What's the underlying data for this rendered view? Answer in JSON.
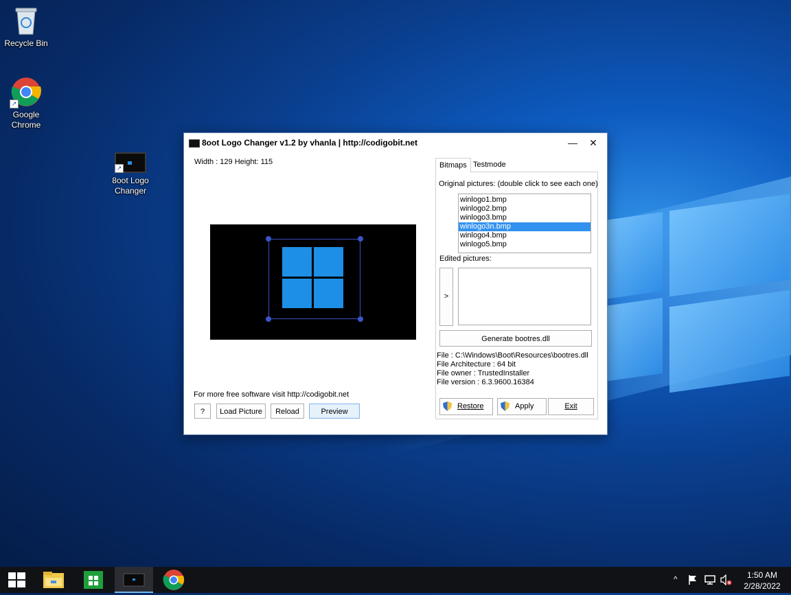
{
  "desktop": {
    "icons": [
      {
        "label": "Recycle Bin"
      },
      {
        "label": "Google Chrome"
      },
      {
        "label": "8oot Logo Changer"
      }
    ]
  },
  "window": {
    "title": "8oot Logo Changer v1.2 by vhanla | http://codigobit.net",
    "minimize_glyph": "—",
    "close_glyph": "✕",
    "dimensions_text": "Width : 129 Height: 115",
    "footer_text": "For more free software visit  http://codigobit.net",
    "buttons": {
      "help": "?",
      "load_picture": "Load Picture",
      "reload": "Reload",
      "preview": "Preview"
    },
    "tabs": [
      "Bitmaps",
      "Testmode"
    ],
    "original_label": "Original pictures: (double click to see each one)",
    "original_files": [
      "winlogo1.bmp",
      "winlogo2.bmp",
      "winlogo3.bmp",
      "winlogo3n.bmp",
      "winlogo4.bmp",
      "winlogo5.bmp"
    ],
    "selected_index": 3,
    "edited_label": "Edited pictures:",
    "move_button": ">",
    "generate_button": "Generate bootres.dll",
    "file_info": {
      "file": "File : C:\\Windows\\Boot\\Resources\\bootres.dll",
      "architecture": "File Architecture : 64 bit",
      "owner": "File owner : TrustedInstaller",
      "version": "File version : 6.3.9600.16384"
    },
    "actions": {
      "restore": "Restore",
      "apply": "Apply",
      "exit": "Exit"
    }
  },
  "taskbar": {
    "time": "1:50 AM",
    "date": "2/28/2022",
    "chevron": "^"
  },
  "colors": {
    "selection": "#3392ef",
    "logo_blue": "#1d8fe6",
    "handle": "#3a55c8",
    "taskbar": "#101216"
  }
}
